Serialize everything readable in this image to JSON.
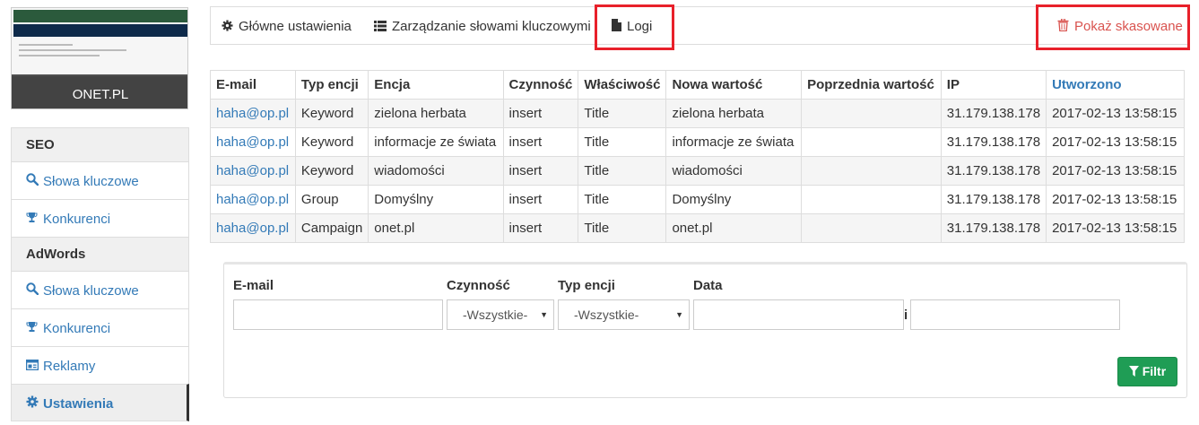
{
  "sidebar": {
    "thumbnail_caption": "ONET.PL",
    "sections": [
      {
        "header": "SEO",
        "items": [
          {
            "label": "Słowa kluczowe",
            "icon": "search-icon"
          },
          {
            "label": "Konkurenci",
            "icon": "trophy-icon"
          }
        ]
      },
      {
        "header": "AdWords",
        "items": [
          {
            "label": "Słowa kluczowe",
            "icon": "search-icon"
          },
          {
            "label": "Konkurenci",
            "icon": "trophy-icon"
          },
          {
            "label": "Reklamy",
            "icon": "ad-icon"
          },
          {
            "label": "Ustawienia",
            "icon": "gear-icon",
            "active": true
          }
        ]
      }
    ]
  },
  "tabs": {
    "general": "Główne ustawienia",
    "keywords": "Zarządzanie słowami kluczowymi",
    "logs": "Logi",
    "show_deleted": "Pokaż skasowane"
  },
  "table": {
    "headers": [
      "E-mail",
      "Typ encji",
      "Encja",
      "Czynność",
      "Właściwość",
      "Nowa wartość",
      "Poprzednia wartość",
      "IP",
      "Utworzono"
    ],
    "rows": [
      [
        "haha@op.pl",
        "Keyword",
        "zielona herbata",
        "insert",
        "Title",
        "zielona herbata",
        "",
        "31.179.138.178",
        "2017-02-13 13:58:15"
      ],
      [
        "haha@op.pl",
        "Keyword",
        "informacje ze świata",
        "insert",
        "Title",
        "informacje ze świata",
        "",
        "31.179.138.178",
        "2017-02-13 13:58:15"
      ],
      [
        "haha@op.pl",
        "Keyword",
        "wiadomości",
        "insert",
        "Title",
        "wiadomości",
        "",
        "31.179.138.178",
        "2017-02-13 13:58:15"
      ],
      [
        "haha@op.pl",
        "Group",
        "Domyślny",
        "insert",
        "Title",
        "Domyślny",
        "",
        "31.179.138.178",
        "2017-02-13 13:58:15"
      ],
      [
        "haha@op.pl",
        "Campaign",
        "onet.pl",
        "insert",
        "Title",
        "onet.pl",
        "",
        "31.179.138.178",
        "2017-02-13 13:58:15"
      ]
    ]
  },
  "filter": {
    "email_label": "E-mail",
    "action_label": "Czynność",
    "entity_label": "Typ encji",
    "date_label": "Data",
    "action_selected": "-Wszystkie-",
    "entity_selected": "-Wszystkie-",
    "date_separator": "i",
    "button": "Filtr"
  },
  "colors": {
    "link": "#337ab7",
    "highlight": "#e8202a",
    "danger": "#d9534f",
    "success": "#1f9d55"
  }
}
